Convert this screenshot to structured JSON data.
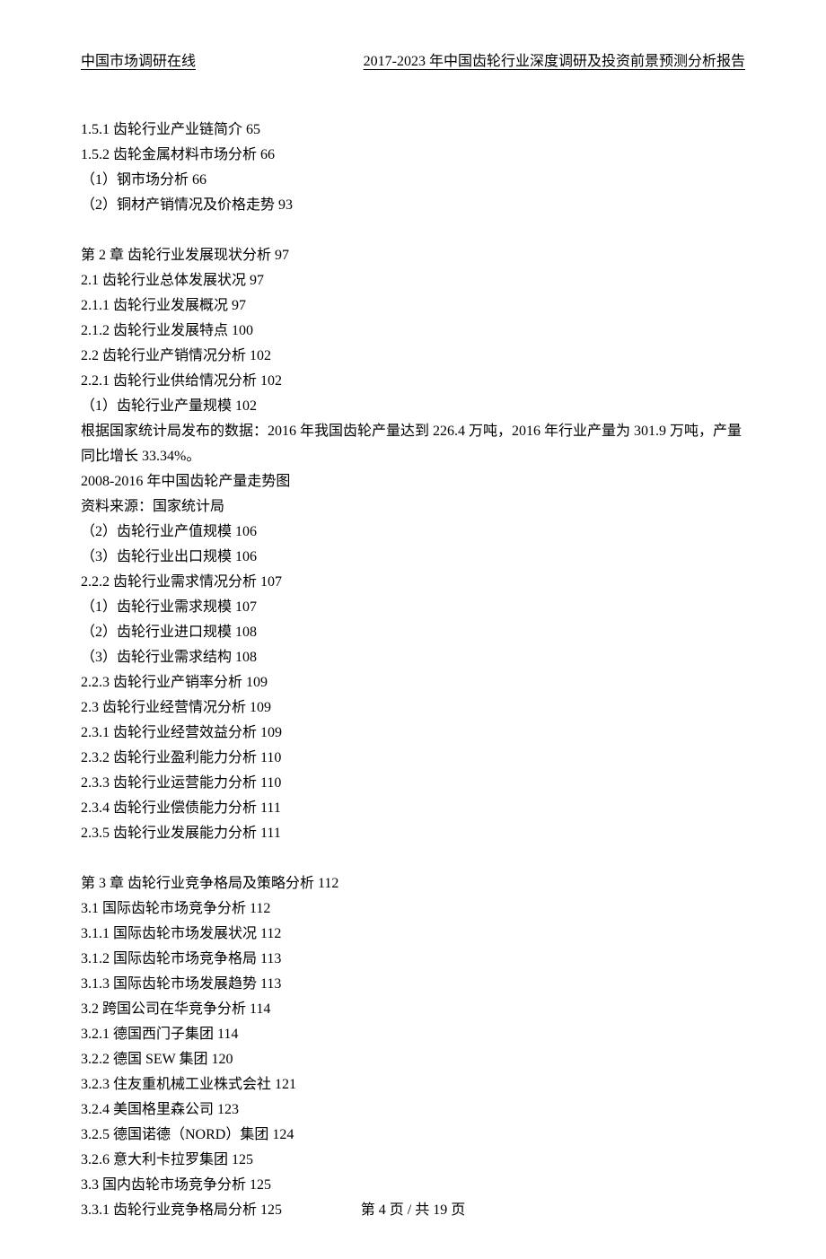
{
  "header": {
    "left": "中国市场调研在线",
    "right": "2017-2023 年中国齿轮行业深度调研及投资前景预测分析报告"
  },
  "content": {
    "lines": [
      "1.5.1 齿轮行业产业链简介 65",
      "1.5.2 齿轮金属材料市场分析 66",
      "（1）钢市场分析 66",
      "（2）铜材产销情况及价格走势 93",
      "",
      "第 2 章 齿轮行业发展现状分析 97",
      "2.1 齿轮行业总体发展状况 97",
      "2.1.1 齿轮行业发展概况 97",
      "2.1.2 齿轮行业发展特点 100",
      "2.2 齿轮行业产销情况分析 102",
      "2.2.1 齿轮行业供给情况分析 102",
      "（1）齿轮行业产量规模 102",
      "根据国家统计局发布的数据：2016 年我国齿轮产量达到 226.4 万吨，2016 年行业产量为 301.9 万吨，产量同比增长 33.34%。",
      "2008-2016 年中国齿轮产量走势图",
      "资料来源：国家统计局",
      "（2）齿轮行业产值规模 106",
      "（3）齿轮行业出口规模 106",
      "2.2.2 齿轮行业需求情况分析 107",
      "（1）齿轮行业需求规模 107",
      "（2）齿轮行业进口规模 108",
      "（3）齿轮行业需求结构 108",
      "2.2.3 齿轮行业产销率分析 109",
      "2.3 齿轮行业经营情况分析 109",
      "2.3.1 齿轮行业经营效益分析 109",
      "2.3.2 齿轮行业盈利能力分析 110",
      "2.3.3 齿轮行业运营能力分析 110",
      "2.3.4 齿轮行业偿债能力分析 111",
      "2.3.5 齿轮行业发展能力分析 111",
      "",
      "第 3 章 齿轮行业竞争格局及策略分析 112",
      "3.1 国际齿轮市场竞争分析 112",
      "3.1.1 国际齿轮市场发展状况 112",
      "3.1.2 国际齿轮市场竞争格局 113",
      "3.1.3 国际齿轮市场发展趋势 113",
      "3.2 跨国公司在华竞争分析 114",
      "3.2.1 德国西门子集团 114",
      "3.2.2 德国 SEW 集团 120",
      "3.2.3 住友重机械工业株式会社 121",
      "3.2.4 美国格里森公司 123",
      "3.2.5 德国诺德（NORD）集团 124",
      "3.2.6 意大利卡拉罗集团 125",
      "3.3 国内齿轮市场竞争分析 125",
      "3.3.1 齿轮行业竞争格局分析 125"
    ]
  },
  "footer": {
    "text": "第 4 页 / 共 19 页"
  }
}
